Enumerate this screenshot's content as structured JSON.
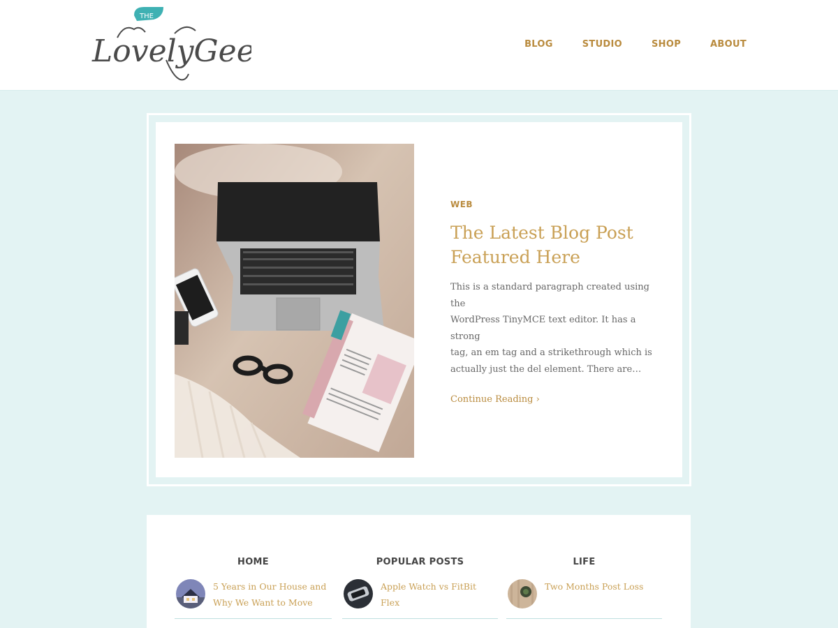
{
  "brand": {
    "logo_top": "THE",
    "logo_main": "LovelyGeek",
    "accent": "#3eb1b3",
    "gold": "#b98b3e"
  },
  "nav": {
    "items": [
      "BLOG",
      "STUDIO",
      "SHOP",
      "ABOUT"
    ]
  },
  "featured": {
    "category": "WEB",
    "title_line1": "The Latest Blog Post",
    "title_line2": "Featured Here",
    "excerpt_lines": [
      "This is a standard paragraph created using the",
      "WordPress TinyMCE text editor. It has a strong",
      "tag, an em tag and a strikethrough which is",
      "actually just the del element. There are…"
    ],
    "continue_label": "Continue Reading ›",
    "image_icon": "laptop-desk-photo"
  },
  "widgets": [
    {
      "heading": "HOME",
      "item_lines": [
        "5 Years in Our House and",
        "Why We Want to Move"
      ],
      "thumb_icon": "house-thumbnail"
    },
    {
      "heading": "POPULAR POSTS",
      "item_lines": [
        "Apple Watch vs FitBit Flex"
      ],
      "thumb_icon": "watch-thumbnail"
    },
    {
      "heading": "LIFE",
      "item_lines": [
        "Two Months Post Loss"
      ],
      "thumb_icon": "plant-thumbnail"
    }
  ]
}
